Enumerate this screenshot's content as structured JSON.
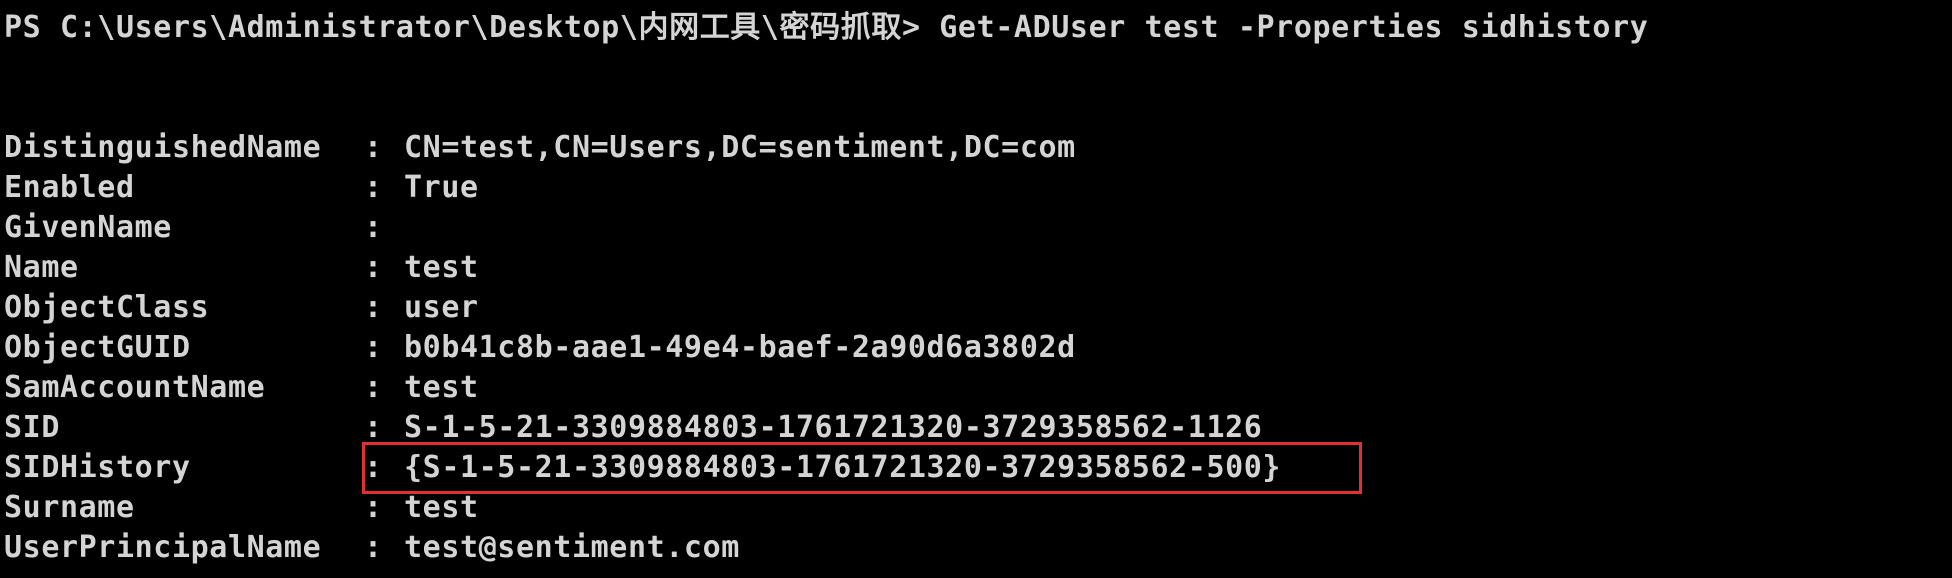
{
  "terminal": {
    "prompt": "PS C:\\Users\\Administrator\\Desktop\\内网工具\\密码抓取> Get-ADUser test -Properties sidhistory",
    "separator": ":",
    "properties": [
      {
        "key": "DistinguishedName",
        "value": "CN=test,CN=Users,DC=sentiment,DC=com"
      },
      {
        "key": "Enabled",
        "value": "True"
      },
      {
        "key": "GivenName",
        "value": ""
      },
      {
        "key": "Name",
        "value": "test"
      },
      {
        "key": "ObjectClass",
        "value": "user"
      },
      {
        "key": "ObjectGUID",
        "value": "b0b41c8b-aae1-49e4-baef-2a90d6a3802d"
      },
      {
        "key": "SamAccountName",
        "value": "test"
      },
      {
        "key": "SID",
        "value": "S-1-5-21-3309884803-1761721320-3729358562-1126"
      },
      {
        "key": "SIDHistory",
        "value": "{S-1-5-21-3309884803-1761721320-3729358562-500}"
      },
      {
        "key": "Surname",
        "value": "test"
      },
      {
        "key": "UserPrincipalName",
        "value": "test@sentiment.com"
      }
    ],
    "highlight_color": "#e0322e"
  }
}
